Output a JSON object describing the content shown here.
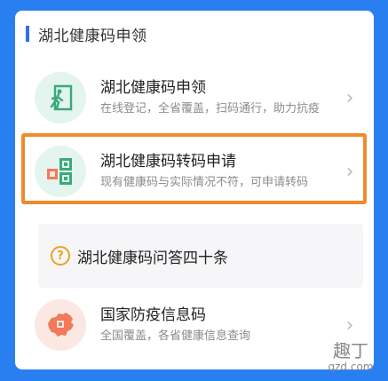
{
  "section": {
    "title": "湖北健康码申领"
  },
  "items": [
    {
      "title": "湖北健康码申领",
      "subtitle": "在线登记，全省覆盖，扫码通行，助力抗疫",
      "icon": "entry-door-icon"
    },
    {
      "title": "湖北健康码转码申请",
      "subtitle": "现有健康码与实际情况不符，可申请转码",
      "icon": "qr-code-icon"
    },
    {
      "title": "国家防疫信息码",
      "subtitle": "全国覆盖，各省健康信息查询",
      "icon": "china-map-icon"
    }
  ],
  "qa": {
    "label": "湖北健康码问答四十条",
    "icon": "question-bubble-icon"
  },
  "watermark": {
    "main": "趣丁",
    "sub": "qzd.com"
  },
  "colors": {
    "background": "#2a7ff0",
    "accent": "#2f6df0",
    "highlight": "#f08a2c"
  }
}
